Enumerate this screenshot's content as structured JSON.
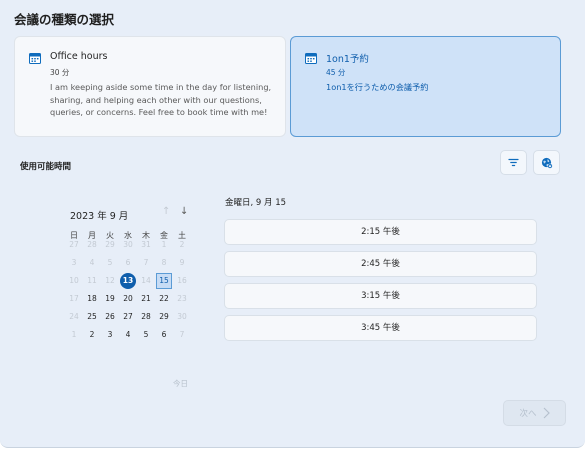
{
  "page": {
    "title": "会議の種類の選択"
  },
  "meeting_types": [
    {
      "icon": "calendar-icon",
      "title": "Office hours",
      "duration": "30 分",
      "description": "I am keeping aside some time in the day for listening, sharing, and helping each other with our questions, queries, or concerns. Feel free to book time with me!",
      "selected": false
    },
    {
      "icon": "calendar-icon",
      "title": "1on1予約",
      "duration": "45 分",
      "description": "1on1を行うための会議予約",
      "selected": true
    }
  ],
  "availability": {
    "label": "使用可能時間",
    "tools": {
      "filter_icon": "filter-icon",
      "timezone_icon": "globe-icon"
    }
  },
  "calendar": {
    "month_label": "2023 年 9 月",
    "weekdays": [
      "日",
      "月",
      "火",
      "水",
      "木",
      "金",
      "土"
    ],
    "weeks": [
      [
        "27",
        "28",
        "29",
        "30",
        "31",
        "1",
        "2"
      ],
      [
        "3",
        "4",
        "5",
        "6",
        "7",
        "8",
        "9"
      ],
      [
        "10",
        "11",
        "12",
        "13",
        "14",
        "15",
        "16"
      ],
      [
        "17",
        "18",
        "19",
        "20",
        "21",
        "22",
        "23"
      ],
      [
        "24",
        "25",
        "26",
        "27",
        "28",
        "29",
        "30"
      ],
      [
        "1",
        "2",
        "3",
        "4",
        "5",
        "6",
        "7"
      ]
    ],
    "muted": [
      [
        true,
        true,
        true,
        true,
        true,
        true,
        true
      ],
      [
        true,
        true,
        true,
        true,
        true,
        true,
        true
      ],
      [
        true,
        true,
        true,
        false,
        true,
        false,
        true
      ],
      [
        true,
        false,
        false,
        false,
        false,
        false,
        true
      ],
      [
        true,
        false,
        false,
        false,
        false,
        false,
        true
      ],
      [
        true,
        false,
        false,
        false,
        false,
        false,
        true
      ]
    ],
    "today": "13",
    "selected_day": "15",
    "today_link": "今日",
    "prev_icon": "arrow-up-icon",
    "next_icon": "arrow-down-icon"
  },
  "slots": {
    "date_heading": "金曜日, 9 月 15",
    "times": [
      "2:15 午後",
      "2:45 午後",
      "3:15 午後",
      "3:45 午後"
    ]
  },
  "footer": {
    "next_label": "次へ",
    "next_icon": "chevron-right-icon"
  },
  "colors": {
    "accent": "#0f5eac",
    "selected_card": "#cfe2f8",
    "panel": "#e7eef8"
  }
}
